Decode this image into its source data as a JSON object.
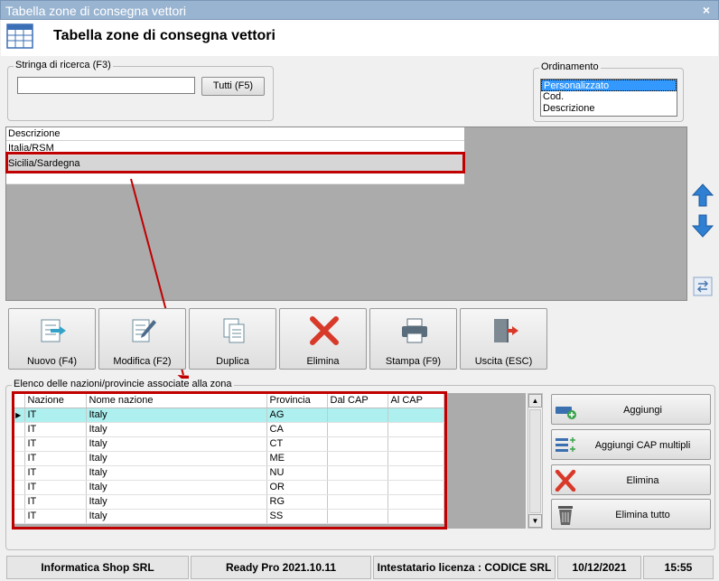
{
  "window": {
    "title": "Tabella zone di consegna vettori",
    "close": "×"
  },
  "header": {
    "title": "Tabella zone di consegna vettori"
  },
  "search": {
    "legend": "Stringa di ricerca (F3)",
    "value": "",
    "all_button": "Tutti (F5)"
  },
  "ordering": {
    "legend": "Ordinamento",
    "options": [
      "Personalizzato",
      "Cod.",
      "Descrizione"
    ],
    "selected": "Personalizzato"
  },
  "zones": {
    "header": "Descrizione",
    "rows": [
      "Italia/RSM",
      "Sicilia/Sardegna"
    ],
    "selected": "Sicilia/Sardegna"
  },
  "toolbar": {
    "new": "Nuovo (F4)",
    "edit": "Modifica (F2)",
    "duplicate": "Duplica",
    "delete": "Elimina",
    "print": "Stampa (F9)",
    "exit": "Uscita (ESC)"
  },
  "nations": {
    "legend": "Elenco delle nazioni/provincie associate alla zona",
    "columns": [
      "Nazione",
      "Nome nazione",
      "Provincia",
      "Dal CAP",
      "Al CAP"
    ],
    "rows": [
      [
        "IT",
        "Italy",
        "AG",
        "",
        ""
      ],
      [
        "IT",
        "Italy",
        "CA",
        "",
        ""
      ],
      [
        "IT",
        "Italy",
        "CT",
        "",
        ""
      ],
      [
        "IT",
        "Italy",
        "ME",
        "",
        ""
      ],
      [
        "IT",
        "Italy",
        "NU",
        "",
        ""
      ],
      [
        "IT",
        "Italy",
        "OR",
        "",
        ""
      ],
      [
        "IT",
        "Italy",
        "RG",
        "",
        ""
      ],
      [
        "IT",
        "Italy",
        "SS",
        "",
        ""
      ]
    ]
  },
  "side_buttons": {
    "add": "Aggiungi",
    "add_multi": "Aggiungi CAP multipli",
    "delete": "Elimina",
    "delete_all": "Elimina tutto"
  },
  "statusbar": {
    "company": "Informatica Shop SRL",
    "version": "Ready Pro 2021.10.11",
    "license": "Intestatario licenza : CODICE SRL",
    "date": "10/12/2021",
    "time": "15:55"
  },
  "colors": {
    "highlight": "#c00000",
    "selection": "#3399ff",
    "row_selected": "#aef0f0"
  }
}
